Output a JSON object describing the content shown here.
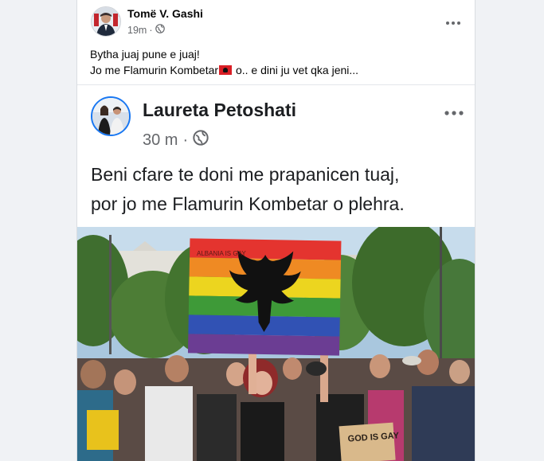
{
  "post": {
    "author": "Tomë V. Gashi",
    "time": "19m",
    "separator": "·",
    "text_line1": "Bytha juaj pune e juaj!",
    "text_line2_before_flag": "Jo me Flamurin Kombetar",
    "text_line2_after_flag": " o.. e dini ju vet qka jeni...",
    "more_icon": "three-dots-icon",
    "privacy_icon": "globe-icon"
  },
  "shared_post": {
    "author": "Laureta Petoshati",
    "time": "30 m",
    "separator": "·",
    "text_line1": "Beni cfare te doni me prapanicen tuaj,",
    "text_line2": "por jo me Flamurin Kombetar o plehra.",
    "more_icon": "three-dots-icon",
    "privacy_icon": "globe-icon"
  },
  "photo": {
    "sign_top": "ALBANIA IS GAY",
    "sign_bottom": "GOD IS GAY"
  },
  "colors": {
    "accent": "#1877f2",
    "flag_red": "#d91e25",
    "text_primary": "#050505",
    "text_secondary": "#65676b"
  }
}
